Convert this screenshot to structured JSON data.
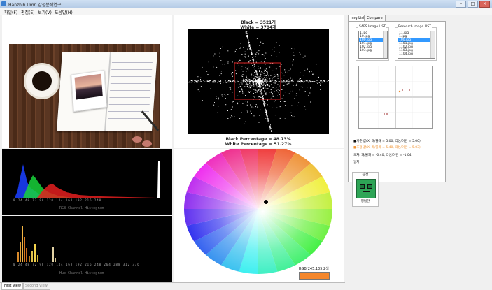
{
  "window": {
    "title": "Hanzhih Umn 감정분석연구",
    "min_label": "–",
    "max_label": "□",
    "close_label": "×"
  },
  "menu": [
    "파일(F)",
    "편집(E)",
    "보기(V)",
    "도움말(H)"
  ],
  "fft": {
    "black_count": "Black = 3521개",
    "white_count": "White = 3784개",
    "black_pct": "Black Percentage = 48.73%",
    "white_pct": "White Percentage = 51.27%"
  },
  "rgb_hist": {
    "caption": "RGB Channel Histogram",
    "ticks": "0  24  48  72  96  120  144  168  192  216  240"
  },
  "hue_hist": {
    "caption": "Hue Channel Histogram",
    "ticks": "0  24  48  72  96  120  144  168  192  216  240  264  288  312  336"
  },
  "color_wheel": {
    "rgb_readout": "RGB(245,135,2색",
    "swatch_color": "#f5872c"
  },
  "right_panel": {
    "tabs": [
      "Img List",
      "Compare"
    ],
    "active_tab": "Img List",
    "saps_group_label": "SAPS Image LIST",
    "saps_items": [
      "1.jpg",
      "10.jpg",
      "100.jpg",
      "101.jpg",
      "102.jpg",
      "103.jpg"
    ],
    "saps_selected_index": 2,
    "research_group_label": "Research  Image LIST",
    "research_items": [
      "11.jpg",
      "1.jpg",
      "100.jpg",
      "1101.jpg",
      "1102.jpg",
      "1103.jpg",
      "1104.jpg"
    ],
    "research_selected_index": 2,
    "legend": [
      {
        "text": "■기준 값(X, 쾌/불쾌 = 5.00, 각성/이완 = 5.00)",
        "color": "#111111"
      },
      {
        "text": "■조정 값(X, 쾌/불쾌 = 5.40, 각성/이완 = 5.03)",
        "color": "#f0922f"
      },
      {
        "text": "오차: 쾌/불쾌 = -0.40, 각성/이완 = -1.04",
        "color": "#111111"
      },
      {
        "text": "일치",
        "color": "#111111"
      }
    ],
    "emotion_label": "감정",
    "emotion_text": "평범한"
  },
  "bottom_tabs": [
    "First View",
    "Second View"
  ],
  "active_bottom_tab": "First View"
}
